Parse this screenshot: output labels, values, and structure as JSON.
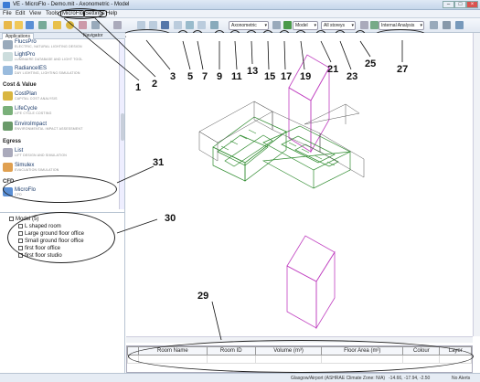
{
  "window": {
    "title": "VE - MicroFlo - Demo.mit - Axonometric - Model"
  },
  "menu": {
    "items": [
      "File",
      "Edit",
      "View",
      "Tools",
      "MicroFlo",
      "Settings",
      "Help"
    ]
  },
  "tabs": {
    "applications": "Applications",
    "navigator": "Navigator"
  },
  "toolbar": {
    "view_mode": "Axonometric",
    "display_mode": "Model",
    "storey": "All storeys",
    "analysis": "Internal Analysis"
  },
  "sidebar": {
    "partial_items": [
      {
        "name": "FlucsPro",
        "desc": "ELECTRIC, NATURAL LIGHTING DESIGN"
      },
      {
        "name": "LightPro",
        "desc": "LUMINAIRE DATABASE AND LIGHT TOOL"
      },
      {
        "name": "RadianceIES",
        "desc": "DAY LIGHTING, LIGHTING SIMULATION"
      }
    ],
    "sections": [
      {
        "title": "Cost & Value",
        "items": [
          {
            "name": "CostPlan",
            "desc": "CAPITAL COST ANALYSIS"
          },
          {
            "name": "LifeCycle",
            "desc": "LIFE CYCLE COSTING"
          },
          {
            "name": "EnviroImpact",
            "desc": "ENVIRONMENTAL IMPACT ASSESSMENT"
          }
        ]
      },
      {
        "title": "Egress",
        "items": [
          {
            "name": "List",
            "desc": "LIFT DESIGN AND SIMULATION"
          },
          {
            "name": "Simulex",
            "desc": "EVACUATION SIMULATION"
          }
        ]
      },
      {
        "title": "CFD",
        "items": [
          {
            "name": "MicroFlo",
            "desc": "CFD"
          }
        ]
      }
    ]
  },
  "model_tree": {
    "root": "Model (5)",
    "rooms": [
      "L shaped room",
      "Large ground floor office",
      "Small ground floor office",
      "first floor office",
      "first floor studio"
    ]
  },
  "grid": {
    "columns": [
      "Room Name",
      "Room ID",
      "Volume (m³)",
      "Floor Area (m²)",
      "Colour",
      "Layer"
    ]
  },
  "status": {
    "location": "Glasgow/Airport (ASHRAE Climate Zone: N/A)",
    "coords": "-14.66, -17.94, -2.50",
    "alerts": "No Alerts"
  },
  "callouts": [
    "1",
    "2",
    "3",
    "5",
    "7",
    "9",
    "11",
    "13",
    "15",
    "17",
    "19",
    "21",
    "23",
    "25",
    "27",
    "29",
    "30",
    "31"
  ],
  "colors": {
    "accent": "#3a7bd5",
    "wire_green": "#2e8b2e",
    "wire_magenta": "#c040c0"
  }
}
